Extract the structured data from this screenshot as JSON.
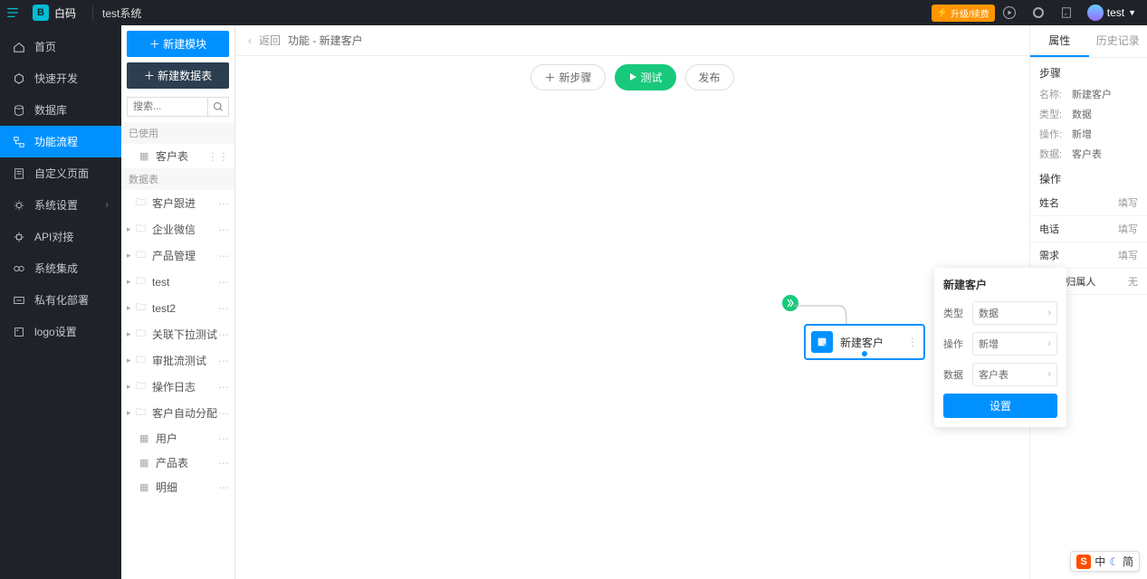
{
  "topbar": {
    "brand": "白码",
    "title": "test系统",
    "upgrade": "升级/续费",
    "user": "test"
  },
  "nav": {
    "items": [
      {
        "label": "首页",
        "icon": "home"
      },
      {
        "label": "快速开发",
        "icon": "cube"
      },
      {
        "label": "数据库",
        "icon": "db"
      },
      {
        "label": "功能流程",
        "icon": "flow"
      },
      {
        "label": "自定义页面",
        "icon": "page"
      },
      {
        "label": "系统设置",
        "icon": "gear",
        "chev": true
      },
      {
        "label": "API对接",
        "icon": "api"
      },
      {
        "label": "系统集成",
        "icon": "integ"
      },
      {
        "label": "私有化部署",
        "icon": "deploy"
      },
      {
        "label": "logo设置",
        "icon": "logo"
      }
    ],
    "active": 3
  },
  "panel2": {
    "btn1": "新建模块",
    "btn2": "新建数据表",
    "search_placeholder": "搜索...",
    "group_used": "已使用",
    "used_items": [
      {
        "label": "客户表"
      }
    ],
    "group_tables": "数据表",
    "tables": [
      {
        "label": "客户跟进",
        "leaf": true,
        "folder": true
      },
      {
        "label": "企业微信",
        "folder": true
      },
      {
        "label": "产品管理",
        "folder": true
      },
      {
        "label": "test",
        "folder": true
      },
      {
        "label": "test2",
        "folder": true
      },
      {
        "label": "关联下拉测试",
        "folder": true
      },
      {
        "label": "审批流测试",
        "folder": true
      },
      {
        "label": "操作日志",
        "folder": true
      },
      {
        "label": "客户自动分配",
        "folder": true
      },
      {
        "label": "用户",
        "leaf": true
      },
      {
        "label": "产品表",
        "leaf": true
      },
      {
        "label": "明细",
        "leaf": true
      }
    ]
  },
  "crumb": {
    "back": "返回",
    "path": "功能 - 新建客户"
  },
  "toolbar": {
    "new_step": "新步骤",
    "test": "测试",
    "publish": "发布"
  },
  "node": {
    "label": "新建客户"
  },
  "popover": {
    "title": "新建客户",
    "rows": [
      {
        "label": "类型",
        "value": "数据"
      },
      {
        "label": "操作",
        "value": "新增"
      },
      {
        "label": "数据",
        "value": "客户表"
      }
    ],
    "btn": "设置"
  },
  "rpanel": {
    "tabs": [
      "属性",
      "历史记录"
    ],
    "active_tab": 0,
    "sec1": "步骤",
    "kv": [
      {
        "k": "名称:",
        "v": "新建客户"
      },
      {
        "k": "类型:",
        "v": "数据"
      },
      {
        "k": "操作:",
        "v": "新增"
      },
      {
        "k": "数据:",
        "v": "客户表"
      }
    ],
    "sec2": "操作",
    "ops": [
      {
        "k": "姓名",
        "v": "填写"
      },
      {
        "k": "电话",
        "v": "填写"
      },
      {
        "k": "需求",
        "v": "填写"
      },
      {
        "k": "* 销售归属人",
        "v": "无"
      }
    ]
  },
  "ime": {
    "mid": "中",
    "right": "简"
  }
}
